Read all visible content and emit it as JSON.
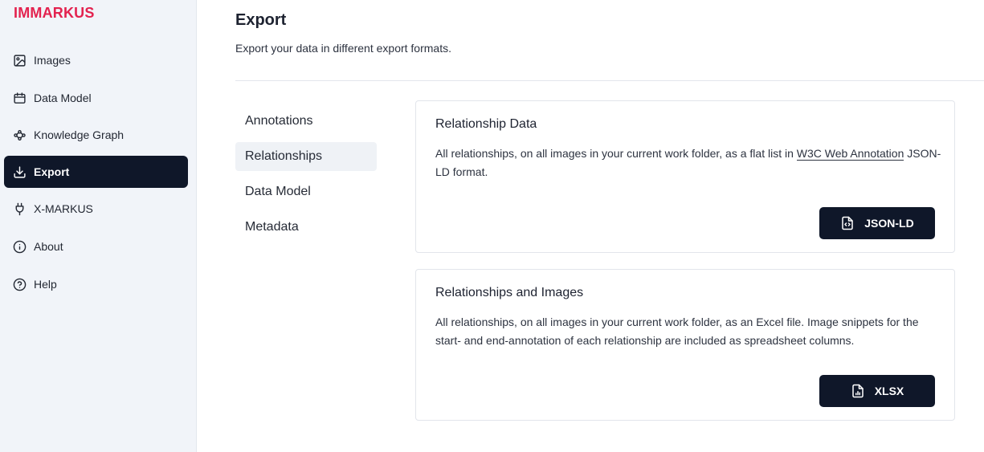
{
  "brand": {
    "name": "IMMARKUS",
    "color": "#e3224f"
  },
  "sidebar": {
    "items": [
      {
        "label": "Images",
        "icon": "image-icon"
      },
      {
        "label": "Data Model",
        "icon": "calendar-icon"
      },
      {
        "label": "Knowledge Graph",
        "icon": "graph-icon"
      },
      {
        "label": "Export",
        "icon": "download-icon",
        "active": true
      },
      {
        "label": "X-MARKUS",
        "icon": "plug-icon"
      },
      {
        "label": "About",
        "icon": "info-icon"
      },
      {
        "label": "Help",
        "icon": "help-icon"
      }
    ]
  },
  "page": {
    "title": "Export",
    "subtitle": "Export your data in different export formats."
  },
  "subnav": {
    "items": [
      {
        "label": "Annotations"
      },
      {
        "label": "Relationships",
        "active": true
      },
      {
        "label": "Data Model"
      },
      {
        "label": "Metadata"
      }
    ]
  },
  "cards": [
    {
      "title": "Relationship Data",
      "desc_before": "All relationships, on all images in your current work folder, as a flat list in ",
      "link": "W3C Web Annotation",
      "desc_after": " JSON-LD format.",
      "button": "JSON-LD",
      "button_icon": "file-code-icon"
    },
    {
      "title": "Relationships and Images",
      "desc": "All relationships, on all images in your current work folder, as an Excel file. Image snippets for the start- and end-annotation of each relationship are included as spreadsheet columns.",
      "button": "XLSX",
      "button_icon": "file-chart-icon"
    }
  ],
  "colors": {
    "accent": "#e3224f",
    "dark": "#0f1729",
    "sidebar_bg": "#f1f4f9"
  }
}
